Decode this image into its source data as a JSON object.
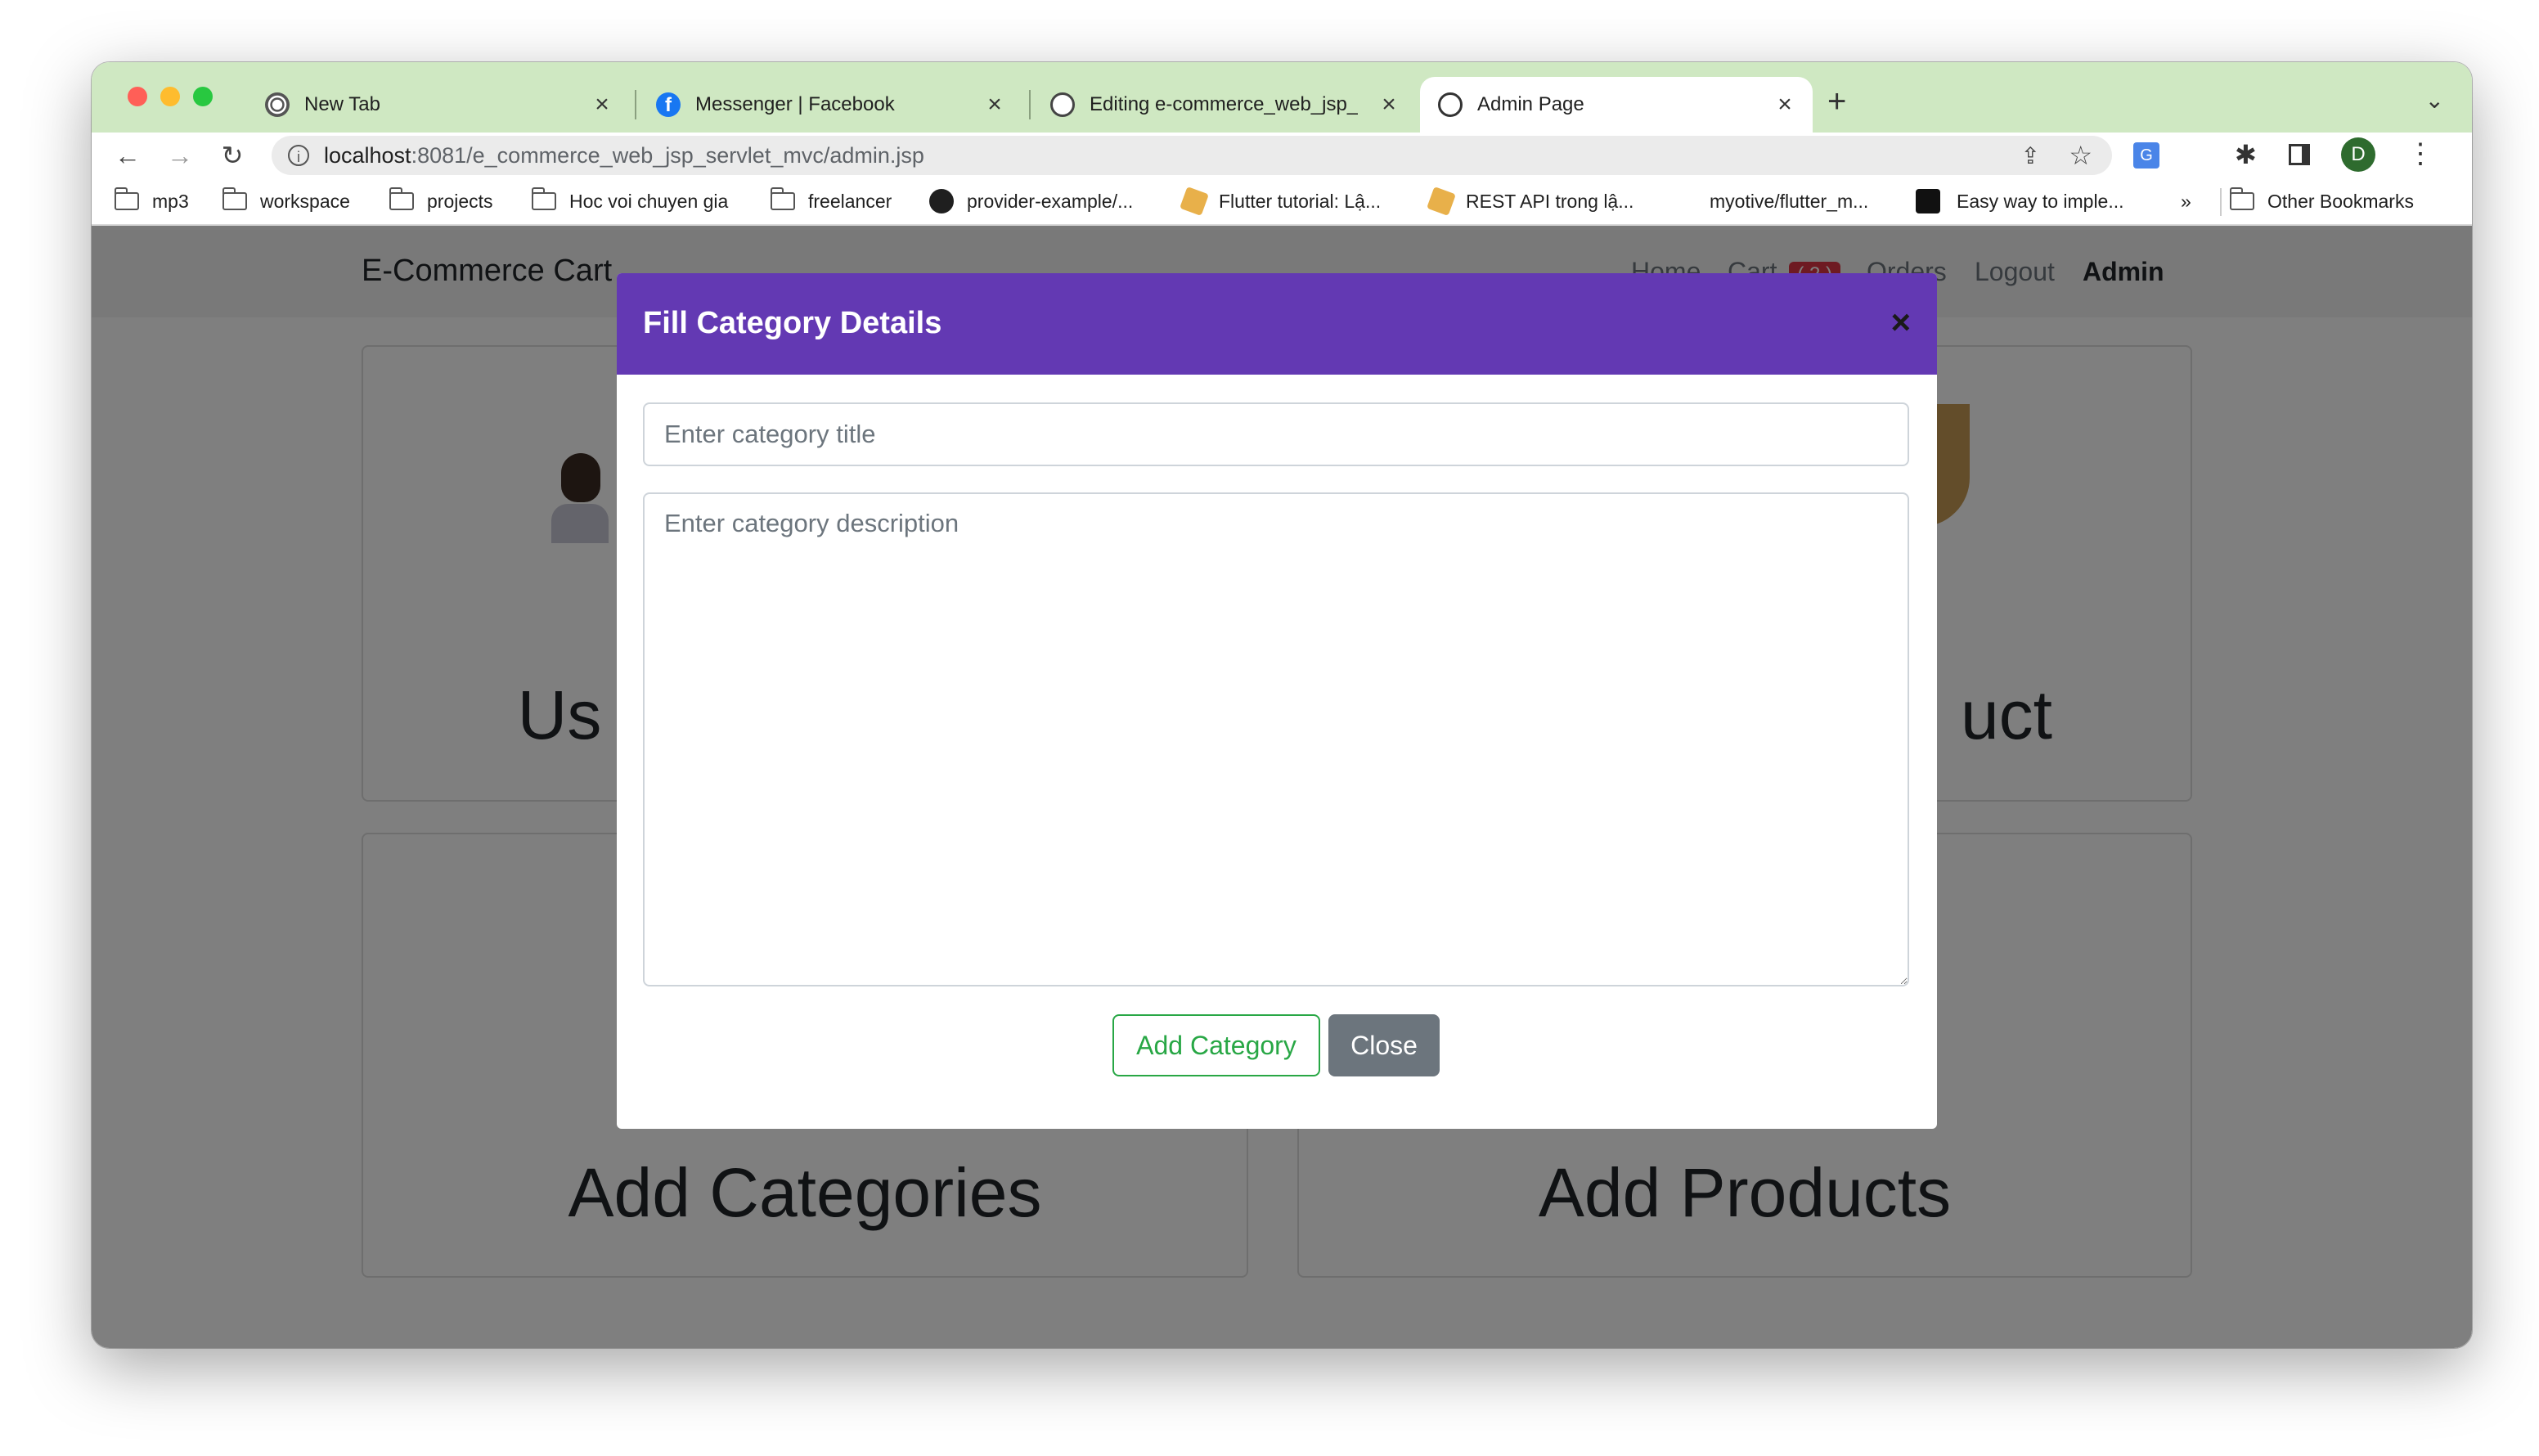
{
  "browser": {
    "tabs": [
      {
        "title": "New Tab",
        "icon": "chrome-icon",
        "active": false
      },
      {
        "title": "Messenger | Facebook",
        "icon": "facebook-icon",
        "active": false
      },
      {
        "title": "Editing e-commerce_web_jsp_",
        "icon": "github-icon",
        "active": false
      },
      {
        "title": "Admin Page",
        "icon": "globe-icon",
        "active": true
      }
    ],
    "url_host": "localhost",
    "url_path": ":8081/e_commerce_web_jsp_servlet_mvc/admin.jsp",
    "profile_initial": "D",
    "bookmarks": [
      {
        "label": "mp3",
        "type": "folder"
      },
      {
        "label": "workspace",
        "type": "folder"
      },
      {
        "label": "projects",
        "type": "folder"
      },
      {
        "label": "Hoc voi chuyen gia",
        "type": "folder"
      },
      {
        "label": "freelancer",
        "type": "folder"
      },
      {
        "label": "provider-example/...",
        "type": "github"
      },
      {
        "label": "Flutter tutorial: Lậ...",
        "type": "site"
      },
      {
        "label": "REST API trong lậ...",
        "type": "site"
      },
      {
        "label": "myotive/flutter_m...",
        "type": "plain"
      },
      {
        "label": "Easy way to imple...",
        "type": "medium"
      }
    ],
    "bookmarks_overflow": "»",
    "other_bookmarks": "Other Bookmarks"
  },
  "page": {
    "brand": "E-Commerce Cart",
    "nav": {
      "home": "Home",
      "cart": "Cart",
      "cart_badge": "( 2 )",
      "orders": "Orders",
      "logout": "Logout",
      "admin": "Admin"
    },
    "cards": {
      "users_partial": "Us",
      "product_partial": "uct",
      "add_categories": "Add Categories",
      "add_products": "Add Products"
    }
  },
  "modal": {
    "title": "Fill Category Details",
    "close_icon": "×",
    "title_placeholder": "Enter category title",
    "description_placeholder": "Enter category description",
    "add_button": "Add Category",
    "close_button": "Close"
  },
  "colors": {
    "tabstrip": "#cfe8c2",
    "modal_header": "#6339b3",
    "success": "#28a745",
    "secondary": "#6c757d",
    "badge": "#dc3545"
  }
}
